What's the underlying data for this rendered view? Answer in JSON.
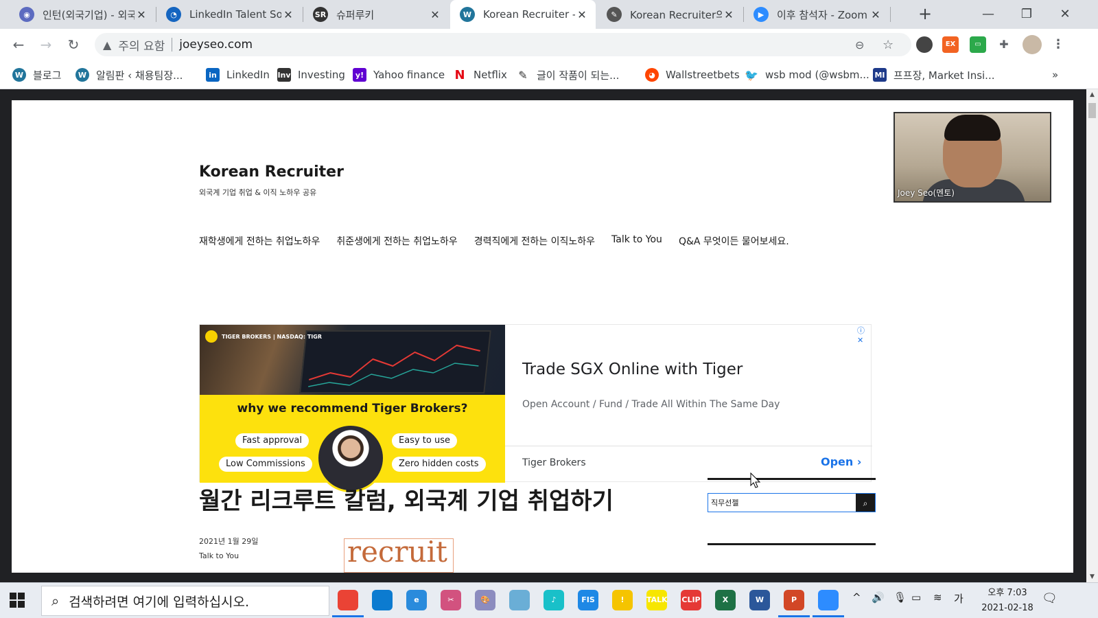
{
  "browser": {
    "tabs": [
      {
        "label": "인턴(외국기업) - 외국",
        "icon": "ink-icon",
        "active": false
      },
      {
        "label": "LinkedIn Talent Solu",
        "icon": "talent-icon",
        "active": false
      },
      {
        "label": "슈퍼루키",
        "icon": "superookie-icon",
        "active": false
      },
      {
        "label": "Korean Recruiter - S",
        "icon": "wordpress-icon",
        "active": true
      },
      {
        "label": "Korean Recruiter의 :",
        "icon": "pen-icon",
        "active": false
      },
      {
        "label": "이후 참석자 - Zoom",
        "icon": "zoom-icon",
        "active": false
      }
    ],
    "new_tab": "+",
    "window_controls": {
      "minimize": "—",
      "restore": "❐",
      "close": "✕"
    },
    "address": {
      "warning": "주의 요함",
      "url": "joeyseo.com"
    },
    "bookmarks": [
      {
        "label": "블로그",
        "icon": "wordpress-icon"
      },
      {
        "label": "알림판 ‹ 채용팀장...",
        "icon": "wordpress-icon"
      },
      {
        "label": "LinkedIn",
        "icon": "linkedin-icon"
      },
      {
        "label": "Investing",
        "icon": "investing-icon"
      },
      {
        "label": "Yahoo finance",
        "icon": "yahoo-icon"
      },
      {
        "label": "Netflix",
        "icon": "netflix-icon"
      },
      {
        "label": "글이 작품이 되는...",
        "icon": "brunch-icon"
      },
      {
        "label": "Wallstreetbets",
        "icon": "reddit-icon"
      },
      {
        "label": "wsb mod (@wsbm...",
        "icon": "twitter-icon"
      },
      {
        "label": "프프장, Market Insi...",
        "icon": "mi-icon"
      }
    ],
    "bookmarks_more": "»"
  },
  "site": {
    "title": "Korean Recruiter",
    "description": "외국계 기업 취업 & 이직 노하우 공유",
    "menu": [
      "재학생에게 전하는 취업노하우",
      "취준생에게 전하는 취업노하우",
      "경력직에게 전하는 이직노하우",
      "Talk to You",
      "Q&A 무엇이든 물어보세요."
    ]
  },
  "ad": {
    "logo_text": "TIGER BROKERS | NASDAQ: TIGR",
    "headline": "why we recommend Tiger Brokers?",
    "pills": [
      "Fast approval",
      "Easy to use",
      "Low Commissions",
      "Zero hidden costs"
    ],
    "title": "Trade SGX Online with Tiger",
    "subtitle": "Open Account / Fund / Trade All Within The Same Day",
    "brand": "Tiger Brokers",
    "cta": "Open",
    "adchoices": "ⓘ ✕"
  },
  "post": {
    "title": "월간 리크루트 칼럼, 외국계 기업 취업하기",
    "date": "2021년 1월 29일",
    "category": "Talk to You",
    "thumb_text": "recruit"
  },
  "sidebar": {
    "search_value": "직무선젤"
  },
  "video": {
    "participant_name": "Joey Seo(멘토)"
  },
  "taskbar": {
    "search_placeholder": "검색하려면 여기에 입력하십시오.",
    "apps": [
      {
        "name": "chrome-icon",
        "label": "",
        "color": "#ea4335",
        "active": true
      },
      {
        "name": "edge-icon",
        "label": "",
        "color": "#0c7bd0",
        "active": false
      },
      {
        "name": "ie-icon",
        "label": "e",
        "color": "#2a8bdc",
        "active": false
      },
      {
        "name": "snip-icon",
        "label": "✂",
        "color": "#d2527f",
        "active": false
      },
      {
        "name": "paint-icon",
        "label": "🎨",
        "color": "#8c8cbf",
        "active": false
      },
      {
        "name": "notepad-icon",
        "label": "",
        "color": "#6aaed6",
        "active": false
      },
      {
        "name": "music-icon",
        "label": "♪",
        "color": "#19c0c9",
        "active": false
      },
      {
        "name": "fis-icon",
        "label": "FIS",
        "color": "#1e88e5",
        "active": false
      },
      {
        "name": "warning-icon",
        "label": "!",
        "color": "#f5c400",
        "active": false
      },
      {
        "name": "kakaotalk-icon",
        "label": "TALK",
        "color": "#f7e600",
        "active": false
      },
      {
        "name": "clip-icon",
        "label": "CLIP",
        "color": "#e53935",
        "active": false
      },
      {
        "name": "excel-icon",
        "label": "X",
        "color": "#1e7145",
        "active": false
      },
      {
        "name": "word-icon",
        "label": "W",
        "color": "#2b579a",
        "active": false
      },
      {
        "name": "powerpoint-icon",
        "label": "P",
        "color": "#d24726",
        "active": true
      },
      {
        "name": "zoom-icon",
        "label": "",
        "color": "#2d8cff",
        "active": true
      }
    ],
    "tray": {
      "ime": "가",
      "time_period": "오후 7:03",
      "date": "2021-02-18"
    }
  }
}
